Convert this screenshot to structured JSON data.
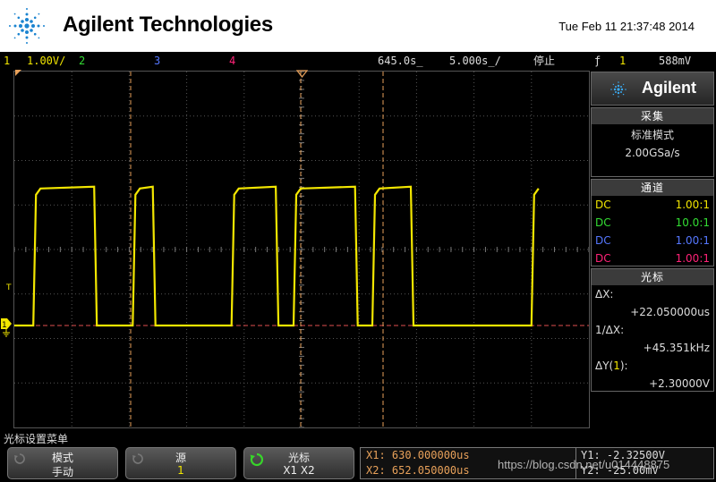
{
  "header": {
    "brand": "Agilent Technologies",
    "datetime": "Tue Feb 11 21:37:48 2014"
  },
  "status_bar": {
    "ch1_num": "1",
    "ch1_scale": "1.00V/",
    "ch2_num": "2",
    "ch3_num": "3",
    "ch4_num": "4",
    "time_delay": "645.0s̲",
    "timebase": "5.000s̲/",
    "run_state": "停止",
    "trigger_slope": "ƒ",
    "trigger_source": "1",
    "trigger_level": "588mV"
  },
  "screen": {
    "trigger_marker": "T",
    "ch1_marker": "1",
    "colors": {
      "ch1": "#f2e600",
      "cursor": "#e8a15a",
      "ground": "#e05050",
      "grid": "#555555"
    },
    "waveform": {
      "low_level": 0,
      "high_level": 3.1,
      "edges_div": [
        0.33,
        1.39,
        2.06,
        2.41,
        3.78,
        4.55,
        4.86,
        5.93,
        6.23,
        6.9,
        9.0
      ]
    }
  },
  "side_panel": {
    "logo": "Agilent",
    "acquire": {
      "title": "采集",
      "mode": "标准模式",
      "rate": "2.00GSa/s"
    },
    "channels": {
      "title": "通道",
      "items": [
        {
          "coupling": "DC",
          "ratio": "1.00:1",
          "color": "#f2e600"
        },
        {
          "coupling": "DC",
          "ratio": "10.0:1",
          "color": "#33dd33"
        },
        {
          "coupling": "DC",
          "ratio": "1.00:1",
          "color": "#5577ff"
        },
        {
          "coupling": "DC",
          "ratio": "1.00:1",
          "color": "#ff2277"
        }
      ]
    },
    "cursors": {
      "title": "光标",
      "dx_label": "ΔX:",
      "dx_value": "+22.050000us",
      "inv_label": "1/ΔX:",
      "inv_value": "+45.351kHz",
      "dy_label_pre": "ΔY(",
      "dy_label_ch": "1",
      "dy_label_post": "):",
      "dy_value": "+2.30000V"
    }
  },
  "softkeys": {
    "menu_title": "光标设置菜单",
    "mode_label": "模式",
    "mode_value": "手动",
    "source_label": "源",
    "source_value": "1",
    "cursor_label": "光标",
    "cursor_value": "X1 X2",
    "x1": "X1: 630.000000us",
    "x2": "X2: 652.050000us",
    "y1": "Y1: -2.32500V",
    "y2": "Y2: -25.00mV"
  },
  "watermark": "https://blog.csdn.net/u014448875"
}
